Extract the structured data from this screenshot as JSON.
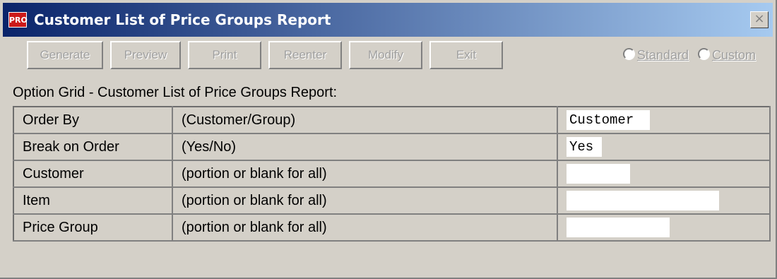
{
  "window": {
    "title": "Customer List of Price Groups Report",
    "app_icon": "PRO",
    "close_glyph": "×"
  },
  "toolbar": {
    "generate": "Generate",
    "preview": "Preview",
    "print": "Print",
    "reenter": "Reenter",
    "modify": "Modify",
    "exit": "Exit"
  },
  "mode": {
    "standard": "Standard",
    "custom": "Custom",
    "selected": ""
  },
  "grid": {
    "title": "Option Grid -  Customer List of Price Groups Report:",
    "rows": [
      {
        "label": "Order By",
        "hint": "(Customer/Group)",
        "value": "Customer"
      },
      {
        "label": "Break on Order",
        "hint": "(Yes/No)",
        "value": "Yes"
      },
      {
        "label": "Customer",
        "hint": "(portion or blank for all)",
        "value": ""
      },
      {
        "label": "Item",
        "hint": "(portion or blank for all)",
        "value": ""
      },
      {
        "label": "Price Group",
        "hint": "(portion or blank for all)",
        "value": ""
      }
    ]
  },
  "colors": {
    "face": "#d4d0c8",
    "title_start": "#0a246a",
    "title_end": "#a6caf0",
    "disabled_text": "#a0a0a0"
  }
}
